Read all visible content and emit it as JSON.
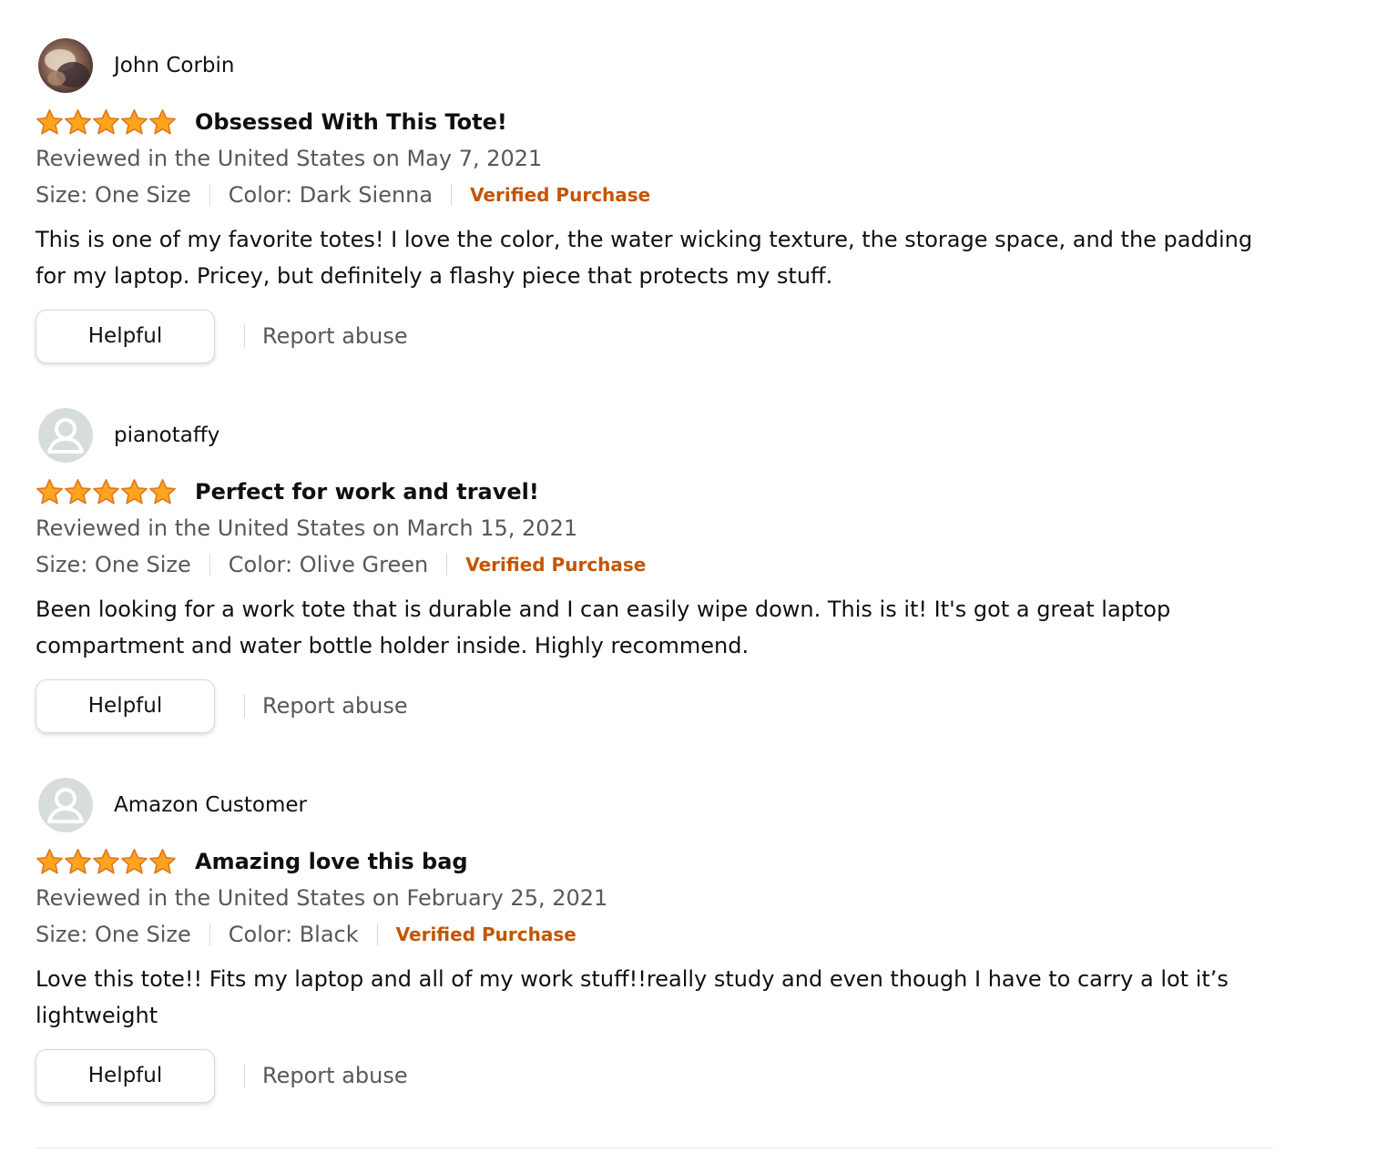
{
  "reviews": [
    {
      "profile_name": "John Corbin",
      "avatar": "photo-avatar",
      "rating": 5,
      "rating_max": 5,
      "title": "Obsessed With This Tote!",
      "date_text": "Reviewed in the United States on May 7, 2021",
      "size": "Size: One Size",
      "color": "Color: Dark Sienna",
      "verified": "Verified Purchase",
      "body": "This is one of my favorite totes! I love the color, the water wicking texture, the storage space, and the padding for my laptop. Pricey, but definitely a flashy piece that protects my stuff.",
      "helpful_label": "Helpful",
      "report_label": "Report abuse"
    },
    {
      "profile_name": "pianotaffy",
      "avatar": "default-user-icon",
      "rating": 5,
      "rating_max": 5,
      "title": "Perfect for work and travel!",
      "date_text": "Reviewed in the United States on March 15, 2021",
      "size": "Size: One Size",
      "color": "Color: Olive Green",
      "verified": "Verified Purchase",
      "body": "Been looking for a work tote that is durable and I can easily wipe down. This is it! It's got a great laptop compartment and water bottle holder inside. Highly recommend.",
      "helpful_label": "Helpful",
      "report_label": "Report abuse"
    },
    {
      "profile_name": "Amazon Customer",
      "avatar": "default-user-icon",
      "rating": 5,
      "rating_max": 5,
      "title": "Amazing love this bag",
      "date_text": "Reviewed in the United States on February 25, 2021",
      "size": "Size: One Size",
      "color": "Color: Black",
      "verified": "Verified Purchase",
      "body": "Love this tote!! Fits my laptop and all of my work stuff!!really study and even though I have to carry a lot it’s lightweight",
      "helpful_label": "Helpful",
      "report_label": "Report abuse"
    }
  ],
  "colors": {
    "star_fill": "#ffa41c",
    "star_stroke": "#de7921",
    "verified": "#c45500",
    "secondary_text": "#565959",
    "primary_text": "#0f1111",
    "avatar_default_bg": "#d7dcdd",
    "avatar_default_fg": "#ffffff"
  }
}
